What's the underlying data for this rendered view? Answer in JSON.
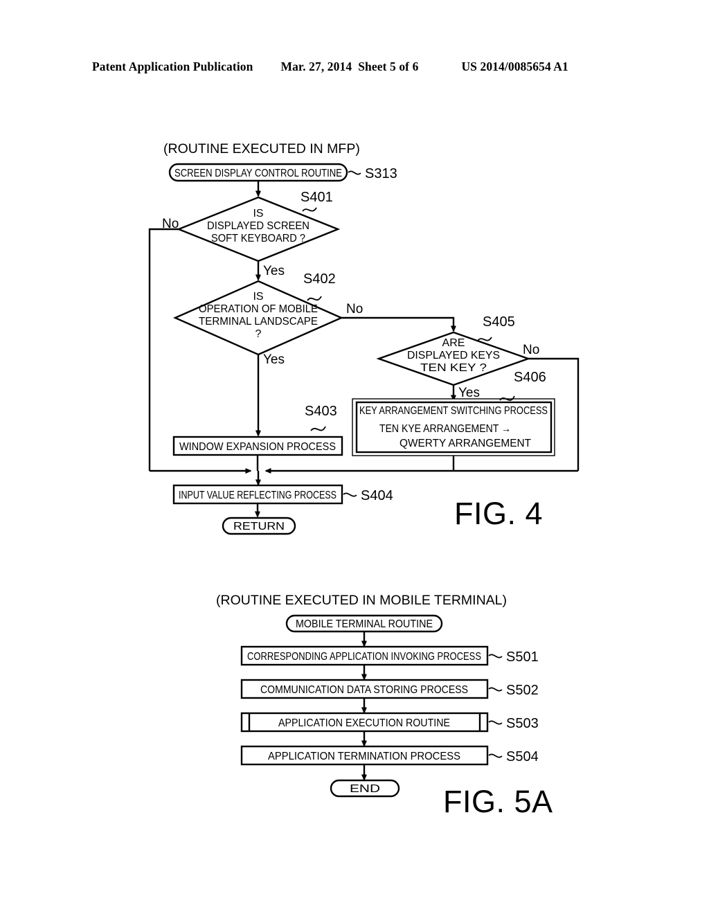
{
  "header": {
    "publication": "Patent Application Publication",
    "date": "Mar. 27, 2014",
    "sheet": "Sheet 5 of 6",
    "patent_number": "US 2014/0085654 A1"
  },
  "figure4": {
    "label": "FIG. 4",
    "caption": "(ROUTINE EXECUTED IN MFP)",
    "nodes": {
      "start": {
        "text": "SCREEN DISPLAY CONTROL ROUTINE",
        "ref": "S313",
        "shape": "terminator"
      },
      "s401": {
        "line1": "IS",
        "line2": "DISPLAYED SCREEN",
        "line3": "SOFT KEYBOARD ?",
        "ref": "S401",
        "shape": "decision",
        "yes": "Yes",
        "no": "No"
      },
      "s402": {
        "line1": "IS",
        "line2": "OPERATION OF MOBILE",
        "line3": "TERMINAL LANDSCAPE",
        "line4": "?",
        "ref": "S402",
        "shape": "decision",
        "yes": "Yes",
        "no": "No"
      },
      "s403": {
        "text": "WINDOW EXPANSION PROCESS",
        "ref": "S403",
        "shape": "process"
      },
      "s405": {
        "line1": "ARE",
        "line2": "DISPLAYED KEYS",
        "line3": "TEN KEY ?",
        "ref": "S405",
        "shape": "decision",
        "yes": "Yes",
        "no": "No"
      },
      "s406": {
        "line1": "KEY ARRANGEMENT SWITCHING PROCESS",
        "line2": "TEN KYE ARRANGEMENT →",
        "line3": "QWERTY ARRANGEMENT",
        "ref": "S406",
        "shape": "process"
      },
      "s404": {
        "text": "INPUT VALUE REFLECTING PROCESS",
        "ref": "S404",
        "shape": "process"
      },
      "end": {
        "text": "RETURN",
        "shape": "terminator"
      }
    }
  },
  "figure5a": {
    "label": "FIG. 5A",
    "caption": "(ROUTINE EXECUTED IN MOBILE TERMINAL)",
    "nodes": {
      "start": {
        "text": "MOBILE TERMINAL ROUTINE",
        "shape": "terminator"
      },
      "s501": {
        "text": "CORRESPONDING APPLICATION INVOKING PROCESS",
        "ref": "S501",
        "shape": "process"
      },
      "s502": {
        "text": "COMMUNICATION DATA STORING PROCESS",
        "ref": "S502",
        "shape": "process"
      },
      "s503": {
        "text": "APPLICATION EXECUTION ROUTINE",
        "ref": "S503",
        "shape": "predefined-process"
      },
      "s504": {
        "text": "APPLICATION TERMINATION PROCESS",
        "ref": "S504",
        "shape": "process"
      },
      "end": {
        "text": "END",
        "shape": "terminator"
      }
    }
  }
}
